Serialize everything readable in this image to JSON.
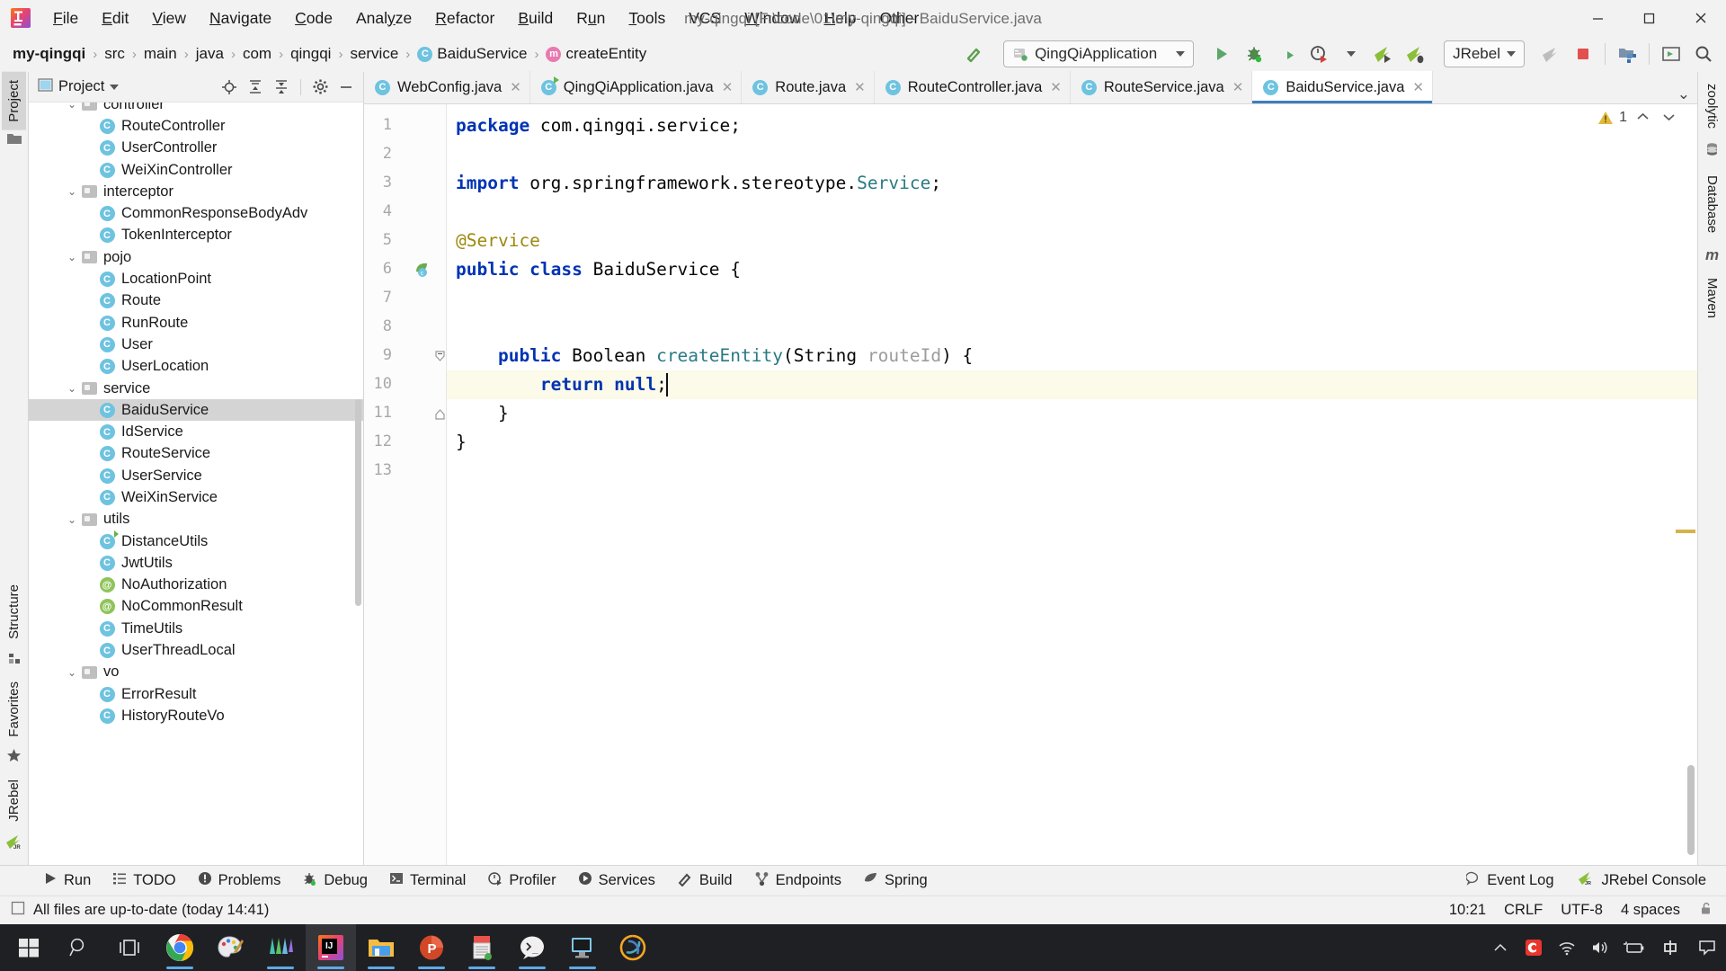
{
  "window": {
    "title": "my-qingqi [F:\\code\\01\\my-qingqi] - BaiduService.java",
    "minimize": "─",
    "maximize": "☐",
    "close": "✕"
  },
  "menu": {
    "items": [
      {
        "label": "File",
        "mnemonic": "F"
      },
      {
        "label": "Edit",
        "mnemonic": "E"
      },
      {
        "label": "View",
        "mnemonic": "V"
      },
      {
        "label": "Navigate",
        "mnemonic": "N"
      },
      {
        "label": "Code",
        "mnemonic": "C"
      },
      {
        "label": "Analyze",
        "mnemonic": "y"
      },
      {
        "label": "Refactor",
        "mnemonic": "R"
      },
      {
        "label": "Build",
        "mnemonic": "B"
      },
      {
        "label": "Run",
        "mnemonic": "u"
      },
      {
        "label": "Tools",
        "mnemonic": "T"
      },
      {
        "label": "VCS",
        "mnemonic": ""
      },
      {
        "label": "Window",
        "mnemonic": "W"
      },
      {
        "label": "Help",
        "mnemonic": "H"
      },
      {
        "label": "Other",
        "mnemonic": ""
      }
    ]
  },
  "breadcrumb": {
    "items": [
      {
        "label": "my-qingqi",
        "icon": "",
        "bold": true
      },
      {
        "label": "src",
        "icon": ""
      },
      {
        "label": "main",
        "icon": ""
      },
      {
        "label": "java",
        "icon": ""
      },
      {
        "label": "com",
        "icon": ""
      },
      {
        "label": "qingqi",
        "icon": ""
      },
      {
        "label": "service",
        "icon": ""
      },
      {
        "label": "BaiduService",
        "icon": "class-icon"
      },
      {
        "label": "createEntity",
        "icon": "method-icon"
      }
    ],
    "separator": "›"
  },
  "toolbar": {
    "run_config": "QingQiApplication",
    "jrebel": "JRebel",
    "icons": [
      "build-hammer-icon",
      "run-icon",
      "debug-icon",
      "run-with-coverage-icon",
      "profiler-icon",
      "jrebel-run-icon",
      "jrebel-debug-icon",
      "update-app-icon",
      "stop-icon",
      "project-structure-icon",
      "select-in-icon",
      "search-everywhere-icon"
    ]
  },
  "left_strip": {
    "top": [
      {
        "label": "Project",
        "selected": true
      }
    ],
    "bottom": [
      {
        "label": "Structure"
      },
      {
        "label": "Favorites"
      },
      {
        "label": "JRebel"
      }
    ]
  },
  "right_strip": {
    "tabs": [
      {
        "label": "zoolytic"
      },
      {
        "label": "Database"
      },
      {
        "label": "Maven"
      }
    ]
  },
  "project_panel": {
    "title": "Project",
    "header_icons": [
      "locate-icon",
      "expand-all-icon",
      "collapse-all-icon",
      "gear-icon",
      "hide-icon"
    ],
    "tree": [
      {
        "label": "controller",
        "type": "folder",
        "indent": 2,
        "arrow": "v",
        "clipped": true
      },
      {
        "label": "RouteController",
        "type": "class",
        "indent": 3
      },
      {
        "label": "UserController",
        "type": "class",
        "indent": 3
      },
      {
        "label": "WeiXinController",
        "type": "class",
        "indent": 3
      },
      {
        "label": "interceptor",
        "type": "folder",
        "indent": 2,
        "arrow": "v"
      },
      {
        "label": "CommonResponseBodyAdv",
        "type": "class",
        "indent": 3
      },
      {
        "label": "TokenInterceptor",
        "type": "class",
        "indent": 3
      },
      {
        "label": "pojo",
        "type": "folder",
        "indent": 2,
        "arrow": "v"
      },
      {
        "label": "LocationPoint",
        "type": "class",
        "indent": 3
      },
      {
        "label": "Route",
        "type": "class",
        "indent": 3
      },
      {
        "label": "RunRoute",
        "type": "class",
        "indent": 3
      },
      {
        "label": "User",
        "type": "class",
        "indent": 3
      },
      {
        "label": "UserLocation",
        "type": "class",
        "indent": 3
      },
      {
        "label": "service",
        "type": "folder",
        "indent": 2,
        "arrow": "v"
      },
      {
        "label": "BaiduService",
        "type": "class",
        "indent": 3,
        "selected": true
      },
      {
        "label": "IdService",
        "type": "class",
        "indent": 3
      },
      {
        "label": "RouteService",
        "type": "class",
        "indent": 3
      },
      {
        "label": "UserService",
        "type": "class",
        "indent": 3
      },
      {
        "label": "WeiXinService",
        "type": "class",
        "indent": 3
      },
      {
        "label": "utils",
        "type": "folder",
        "indent": 2,
        "arrow": "v"
      },
      {
        "label": "DistanceUtils",
        "type": "class-run",
        "indent": 3
      },
      {
        "label": "JwtUtils",
        "type": "class",
        "indent": 3
      },
      {
        "label": "NoAuthorization",
        "type": "annotation",
        "indent": 3
      },
      {
        "label": "NoCommonResult",
        "type": "annotation",
        "indent": 3
      },
      {
        "label": "TimeUtils",
        "type": "class",
        "indent": 3
      },
      {
        "label": "UserThreadLocal",
        "type": "class",
        "indent": 3
      },
      {
        "label": "vo",
        "type": "folder",
        "indent": 2,
        "arrow": "v"
      },
      {
        "label": "ErrorResult",
        "type": "class",
        "indent": 3
      },
      {
        "label": "HistoryRouteVo",
        "type": "class",
        "indent": 3,
        "clipped": true
      }
    ]
  },
  "editor": {
    "tabs": [
      {
        "label": "WebConfig.java",
        "icon": "class-icon",
        "active": false
      },
      {
        "label": "QingQiApplication.java",
        "icon": "class-run-icon",
        "active": false
      },
      {
        "label": "Route.java",
        "icon": "class-icon",
        "active": false
      },
      {
        "label": "RouteController.java",
        "icon": "class-icon",
        "active": false
      },
      {
        "label": "RouteService.java",
        "icon": "class-icon",
        "active": false
      },
      {
        "label": "BaiduService.java",
        "icon": "class-icon",
        "active": true
      }
    ],
    "tab_close": "✕",
    "tabs_more": "⌄",
    "inspection": {
      "warning_count": "1",
      "up": "⌃",
      "down": "⌄"
    },
    "line_numbers": [
      "1",
      "2",
      "3",
      "4",
      "5",
      "6",
      "7",
      "8",
      "9",
      "10",
      "11",
      "12",
      "13"
    ],
    "current_line": 10,
    "code_lines": [
      {
        "n": 1,
        "tokens": [
          {
            "t": "package ",
            "c": "kw"
          },
          {
            "t": "com.qingqi.service;",
            "c": ""
          }
        ]
      },
      {
        "n": 2,
        "tokens": []
      },
      {
        "n": 3,
        "tokens": [
          {
            "t": "import ",
            "c": "kw"
          },
          {
            "t": "org.springframework.stereotype.",
            "c": ""
          },
          {
            "t": "Service",
            "c": "meth"
          },
          {
            "t": ";",
            "c": ""
          }
        ]
      },
      {
        "n": 4,
        "tokens": []
      },
      {
        "n": 5,
        "tokens": [
          {
            "t": "@Service",
            "c": "anno"
          }
        ]
      },
      {
        "n": 6,
        "tokens": [
          {
            "t": "public class ",
            "c": "kw"
          },
          {
            "t": "BaiduService {",
            "c": ""
          }
        ]
      },
      {
        "n": 7,
        "tokens": []
      },
      {
        "n": 8,
        "tokens": []
      },
      {
        "n": 9,
        "tokens": [
          {
            "t": "    ",
            "c": ""
          },
          {
            "t": "public ",
            "c": "kw"
          },
          {
            "t": "Boolean ",
            "c": ""
          },
          {
            "t": "createEntity",
            "c": "meth"
          },
          {
            "t": "(String ",
            "c": ""
          },
          {
            "t": "routeId",
            "c": "param"
          },
          {
            "t": ") {",
            "c": ""
          }
        ]
      },
      {
        "n": 10,
        "tokens": [
          {
            "t": "        ",
            "c": ""
          },
          {
            "t": "return null",
            "c": "kw"
          },
          {
            "t": ";",
            "c": ""
          }
        ]
      },
      {
        "n": 11,
        "tokens": [
          {
            "t": "    }",
            "c": ""
          }
        ]
      },
      {
        "n": 12,
        "tokens": [
          {
            "t": "}",
            "c": ""
          }
        ]
      },
      {
        "n": 13,
        "tokens": []
      }
    ]
  },
  "tool_window_bar": {
    "items": [
      {
        "label": "Run",
        "icon": "run-icon"
      },
      {
        "label": "TODO",
        "icon": "todo-icon"
      },
      {
        "label": "Problems",
        "icon": "problems-icon"
      },
      {
        "label": "Debug",
        "icon": "debug-icon"
      },
      {
        "label": "Terminal",
        "icon": "terminal-icon"
      },
      {
        "label": "Profiler",
        "icon": "profiler-icon"
      },
      {
        "label": "Services",
        "icon": "services-icon"
      },
      {
        "label": "Build",
        "icon": "build-icon"
      },
      {
        "label": "Endpoints",
        "icon": "endpoints-icon"
      },
      {
        "label": "Spring",
        "icon": "spring-icon"
      }
    ],
    "right": [
      {
        "label": "Event Log",
        "icon": "event-log-icon"
      },
      {
        "label": "JRebel Console",
        "icon": "jrebel-icon"
      }
    ]
  },
  "status_bar": {
    "message": "All files are up-to-date (today 14:41)",
    "message_icon": "save-icon",
    "position": "10:21",
    "line_sep": "CRLF",
    "encoding": "UTF-8",
    "indent": "4 spaces",
    "lock_icon": "unlocked-icon"
  },
  "taskbar": {
    "items": [
      {
        "name": "start-button",
        "icon": "windows-logo"
      },
      {
        "name": "search-button",
        "icon": "search-icon"
      },
      {
        "name": "task-view-button",
        "icon": "task-view-icon"
      },
      {
        "name": "chrome-app",
        "icon": "chrome-icon",
        "running": true
      },
      {
        "name": "paint-app",
        "icon": "paint-icon",
        "running": false
      },
      {
        "name": "webstorm-app",
        "icon": "webstorm-icon",
        "running": true
      },
      {
        "name": "intellij-app",
        "icon": "intellij-icon",
        "running": true,
        "active": true
      },
      {
        "name": "explorer-app",
        "icon": "folder-icon",
        "running": true
      },
      {
        "name": "powerpoint-app",
        "icon": "powerpoint-icon",
        "running": true
      },
      {
        "name": "notes-app",
        "icon": "notes-icon",
        "running": true
      },
      {
        "name": "wechat-dev-app",
        "icon": "wechat-devtools-icon",
        "running": true
      },
      {
        "name": "remote-desktop-app",
        "icon": "remote-desktop-icon",
        "running": true
      },
      {
        "name": "postman-app",
        "icon": "postman-icon",
        "running": false
      }
    ],
    "tray": [
      {
        "name": "show-hidden-icons",
        "glyph": "∧"
      },
      {
        "name": "clipboard-icon",
        "glyph": "C"
      },
      {
        "name": "wifi-icon",
        "glyph": ""
      },
      {
        "name": "volume-icon",
        "glyph": ""
      },
      {
        "name": "battery-icon",
        "glyph": ""
      },
      {
        "name": "ime-icon",
        "glyph": "中"
      },
      {
        "name": "notifications-icon",
        "glyph": ""
      }
    ]
  },
  "colors": {
    "accent": "#3d7ebf",
    "keyword": "#0033b3",
    "annotation": "#9e880d",
    "method": "#2a7a82",
    "warning": "#e2b93d",
    "selection": "#d4d4d4"
  }
}
